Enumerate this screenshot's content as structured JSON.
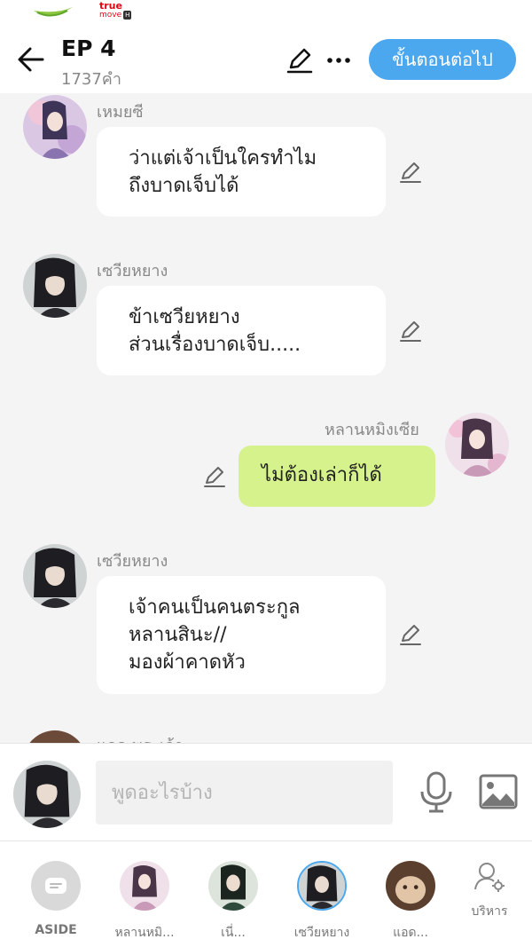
{
  "status": {
    "carrier": "true",
    "carrier_sub": "move",
    "carrier_h": "H"
  },
  "header": {
    "title": "EP 4",
    "word_count": "1737คำ",
    "next_button": "ขั้นตอนต่อไป",
    "back_icon": "back-arrow-icon",
    "edit_icon": "pen-icon",
    "more_icon": "more-dots-icon"
  },
  "messages": [
    {
      "side": "left",
      "name": "เหมยซี",
      "text": "ว่าแต่เจ้าเป็นใครทำไม\nถึงบาดเจ็บได้"
    },
    {
      "side": "left",
      "name": "เซวียหยาง",
      "text": "ข้าเซวียหยาง\nส่วนเรื่องบาดเจ็บ....."
    },
    {
      "side": "right",
      "name": "หลานหมิงเซีย",
      "text": "ไม่ต้องเล่าก็ได้"
    },
    {
      "side": "left",
      "name": "เซวียหยาง",
      "text": "เจ้าคนเป็นคนตระกูล\nหลานสินะ//\nมองผ้าคาดหัว"
    },
    {
      "side": "left",
      "name": "แอด พระเจ้า",
      "text": ""
    }
  ],
  "compose": {
    "placeholder": "พูดอะไรบ้าง",
    "mic_icon": "microphone-icon",
    "image_icon": "image-icon"
  },
  "characters": [
    {
      "label": "ASIDE"
    },
    {
      "label": "หลานหมิ..."
    },
    {
      "label": "เนี่..."
    },
    {
      "label": "เซวียหยาง"
    },
    {
      "label": "แอด..."
    }
  ],
  "manage": {
    "label": "บริหาร",
    "icon": "user-settings-icon"
  },
  "colors": {
    "accent": "#4ba7ee",
    "own_bubble": "#d6f28c",
    "background": "#f4f4f4"
  }
}
